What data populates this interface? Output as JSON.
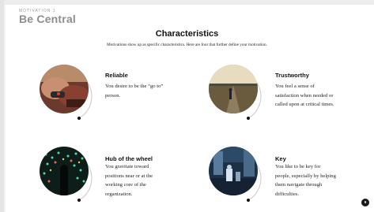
{
  "header": {
    "eyebrow": "MOTIVATION 1",
    "title": "Be Central"
  },
  "main": {
    "title": "Characteristics",
    "subtitle": "Motivations show up as specific characteristics. Here are four that further define your motivation."
  },
  "cards": [
    {
      "title": "Reliable",
      "lines": [
        "You desire to be the “go to”",
        "person."
      ]
    },
    {
      "title": "Trustworthy",
      "lines": [
        "You feel a sense of",
        "satisfaction when needed or",
        "called upon at critical times."
      ]
    },
    {
      "title": "Hub of the wheel",
      "lines": [
        "You gravitate toward",
        "positions near or at the",
        "working core of the",
        "organization."
      ]
    },
    {
      "title": "Key",
      "lines": [
        "You like to be key for",
        "people, especially by helping",
        "them navigate through",
        "difficulties."
      ]
    }
  ],
  "footer": {
    "page_number": "9"
  },
  "colors": {
    "ring": "#c8c8c8",
    "dot": "#111111",
    "title_gray": "#8e8e8e"
  }
}
